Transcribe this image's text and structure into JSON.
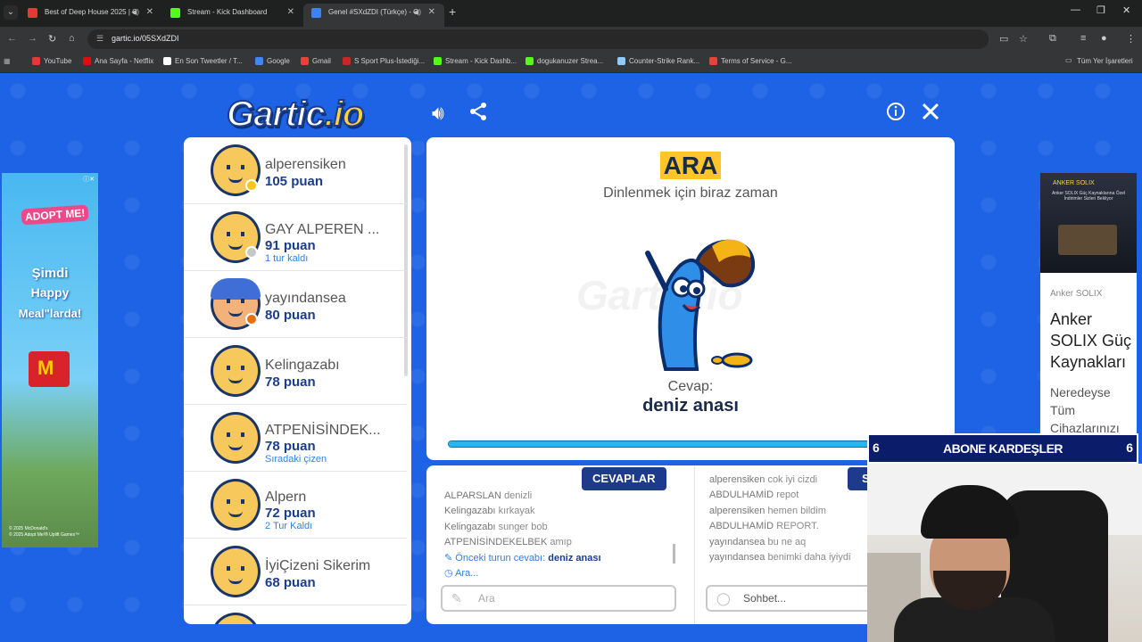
{
  "browser": {
    "tabs": [
      {
        "title": "Best of Deep House 2025 | C",
        "color": "#e53935"
      },
      {
        "title": "Stream - Kick Dashboard",
        "color": "#53fc18"
      },
      {
        "title": "Genel #SXdZDI (Türkçe) - G",
        "color": "#3b82f6"
      }
    ],
    "url": "gartic.io/05SXdZDI",
    "bookmarks": [
      {
        "label": "YouTube",
        "color": "#e53935"
      },
      {
        "label": "Ana Sayfa - Netflix",
        "color": "#e50914"
      },
      {
        "label": "En Son Tweetler / T...",
        "color": "#ffffff"
      },
      {
        "label": "Google",
        "color": "#4285f4"
      },
      {
        "label": "Gmail",
        "color": "#ea4335"
      },
      {
        "label": "S Sport Plus-İstediği...",
        "color": "#c62828"
      },
      {
        "label": "Stream - Kick Dashb...",
        "color": "#53fc18"
      },
      {
        "label": "dogukanuzer Strea...",
        "color": "#53fc18"
      },
      {
        "label": "Counter-Strike Rank...",
        "color": "#90caf9"
      },
      {
        "label": "Terms of Service - G...",
        "color": "#ea4335"
      }
    ],
    "bookmarks_folder": "Tüm Yer İşaretleri"
  },
  "logo": {
    "main": "Gartic",
    "suffix": ".io"
  },
  "left_ad": {
    "brand": "ADOPT ME!",
    "line1": "Şimdi",
    "line2": "Happy",
    "line3": "Meal\"larda!",
    "copyright": "© 2025 McDonald's\n© 2025 Adopt Me!® Uplift Games™"
  },
  "players": [
    {
      "name": "alperensiken",
      "score": "105 puan",
      "note": "",
      "dot": "#f5c518",
      "avatar": "default"
    },
    {
      "name": "GAY ALPEREN ...",
      "score": "91 puan",
      "note": "1 tur kaldı",
      "dot": "#c8c8c8",
      "avatar": "default"
    },
    {
      "name": "yayındansea",
      "score": "80 puan",
      "note": "",
      "dot": "#e76f10",
      "avatar": "blue"
    },
    {
      "name": "Kelingazabı",
      "score": "78 puan",
      "note": "",
      "dot": "",
      "avatar": "default"
    },
    {
      "name": "ATPENİSİNDEK...",
      "score": "78 puan",
      "note": "Sıradaki çizen",
      "dot": "",
      "avatar": "default"
    },
    {
      "name": "Alpern",
      "score": "72 puan",
      "note": "2 Tur Kaldı",
      "dot": "",
      "avatar": "default"
    },
    {
      "name": "İyiÇizeni Sikerim",
      "score": "68 puan",
      "note": "",
      "dot": "",
      "avatar": "default"
    }
  ],
  "main": {
    "title": "ARA",
    "subtitle": "Dinlenmek için biraz zaman",
    "watermark": "Gartic.io",
    "answer_label": "Cevap:",
    "answer_value": "deniz anası",
    "progress": 0.91
  },
  "answers": {
    "badge": "CEVAPLAR",
    "messages": [
      {
        "user": "ALPARSLAN",
        "text": "denizli"
      },
      {
        "user": "Kelingazabı",
        "text": "kırkayak"
      },
      {
        "user": "Kelingazabı",
        "text": "sunger bob"
      },
      {
        "user": "ATPENİSİNDEKELBEK",
        "text": "amıp"
      }
    ],
    "prev_answer_label": "Önceki turun cevabı:",
    "prev_answer_value": "deniz anası",
    "timer_text": "Ara...",
    "input_placeholder": "Ara"
  },
  "chat": {
    "badge": "S",
    "messages": [
      {
        "user": "alperensiken",
        "text": "cok iyi cizdi"
      },
      {
        "user": "ABDULHAMİD",
        "text": "repot"
      },
      {
        "user": "alperensiken",
        "text": "hemen bildim"
      },
      {
        "user": "ABDULHAMİD",
        "text": "REPORT."
      },
      {
        "user": "yayındansea",
        "text": "bu ne aq"
      },
      {
        "user": "yayındansea",
        "text": "benimki daha iyiydi"
      }
    ],
    "input_placeholder": "Sohbet..."
  },
  "right_ad": {
    "image_brand": "ANKER SOLIX",
    "image_text": "Anker SOLIX Güç Kaynaklarına Özel İndirimler Sizleri Bekliyor",
    "brand": "Anker SOLIX",
    "headline": "Anker SOLIX Güç Kaynakları",
    "description": "Neredeyse Tüm Cihazlarınızı"
  },
  "overlay": {
    "left_num": "6",
    "title": "ABONE KARDEŞLER",
    "right_num": "6"
  }
}
